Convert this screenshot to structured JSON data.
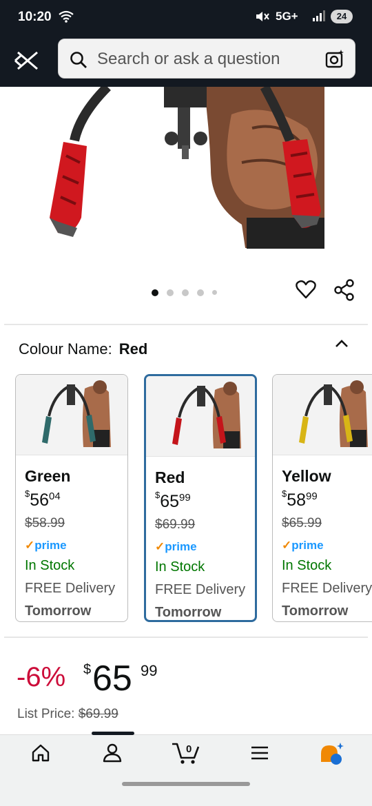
{
  "status": {
    "time": "10:20",
    "network": "5G+",
    "battery": "24"
  },
  "search": {
    "placeholder": "Search or ask a question"
  },
  "colour": {
    "label": "Colour Name:",
    "selected": "Red"
  },
  "options": [
    {
      "name": "Green",
      "currency": "$",
      "whole": "56",
      "cents": "04",
      "was": "$58.99",
      "prime": "prime",
      "stock": "In Stock",
      "delivery": "FREE Delivery",
      "when": "Tomorrow",
      "handle_color": "#2f6a6a"
    },
    {
      "name": "Red",
      "currency": "$",
      "whole": "65",
      "cents": "99",
      "was": "$69.99",
      "prime": "prime",
      "stock": "In Stock",
      "delivery": "FREE Delivery",
      "when": "Tomorrow",
      "handle_color": "#c4141a"
    },
    {
      "name": "Yellow",
      "currency": "$",
      "whole": "58",
      "cents": "99",
      "was": "$65.99",
      "prime": "prime",
      "stock": "In Stock",
      "delivery": "FREE Delivery",
      "when": "Tomorrow",
      "handle_color": "#d8b516"
    }
  ],
  "pricing": {
    "discount": "-6%",
    "currency": "$",
    "whole": "65",
    "cents": "99",
    "list_label": "List Price:",
    "list_value": "$69.99"
  },
  "carousel": {
    "count": 5,
    "active_index": 0
  },
  "colors": {
    "header": "#131921",
    "discount": "#cc0c39",
    "stock": "#007600",
    "prime": "#1a98ff",
    "selected_border": "#2e6b9e"
  },
  "cart": {
    "count": "0"
  },
  "nav": {
    "items": [
      "home-icon",
      "account-icon",
      "cart-icon",
      "menu-icon",
      "rufus-icon"
    ]
  }
}
